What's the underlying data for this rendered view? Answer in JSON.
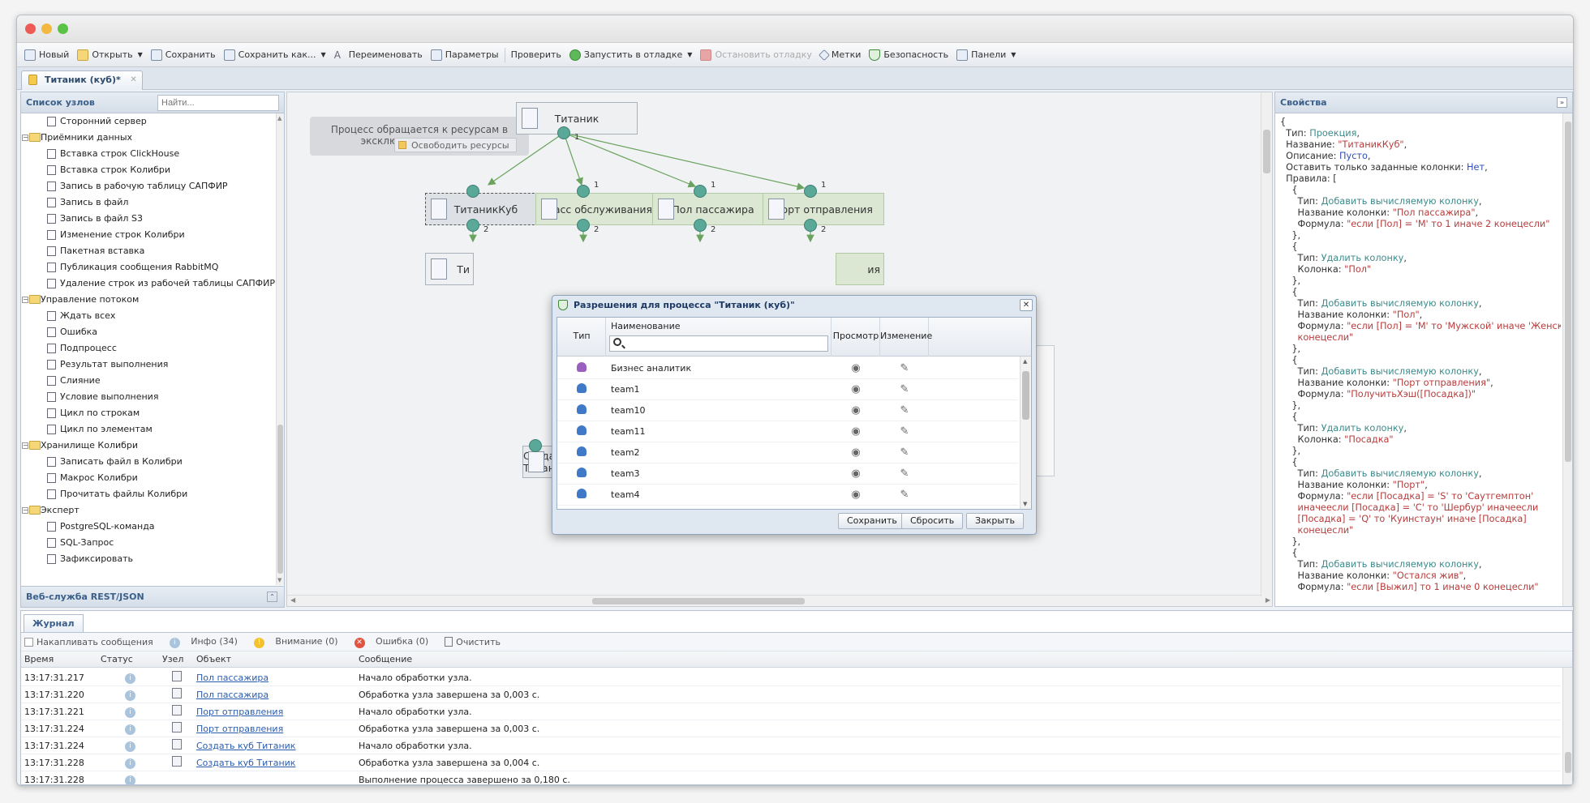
{
  "toolbar": {
    "new": "Новый",
    "open": "Открыть",
    "save": "Сохранить",
    "save_as": "Сохранить как...",
    "rename": "Переименовать",
    "params": "Параметры",
    "check": "Проверить",
    "run_debug": "Запустить в отладке",
    "stop_debug": "Остановить отладку",
    "tags": "Метки",
    "security": "Безопасность",
    "panels": "Панели"
  },
  "tab": {
    "label": "Титаник (куб)*"
  },
  "left": {
    "title": "Список узлов",
    "search_placeholder": "Найти...",
    "footer": "Веб-служба REST/JSON",
    "items": [
      {
        "t": "leaf",
        "label": "Сторонний сервер"
      },
      {
        "t": "grp",
        "label": "Приёмники данных"
      },
      {
        "t": "leaf",
        "label": "Вставка строк ClickHouse"
      },
      {
        "t": "leaf",
        "label": "Вставка строк Колибри"
      },
      {
        "t": "leaf",
        "label": "Запись в рабочую таблицу САПФИР"
      },
      {
        "t": "leaf",
        "label": "Запись в файл"
      },
      {
        "t": "leaf",
        "label": "Запись в файл S3"
      },
      {
        "t": "leaf",
        "label": "Изменение строк Колибри"
      },
      {
        "t": "leaf",
        "label": "Пакетная вставка"
      },
      {
        "t": "leaf",
        "label": "Публикация сообщения RabbitMQ"
      },
      {
        "t": "leaf",
        "label": "Удаление строк из рабочей таблицы САПФИР"
      },
      {
        "t": "grp",
        "label": "Управление потоком"
      },
      {
        "t": "leaf",
        "label": "Ждать всех"
      },
      {
        "t": "leaf",
        "label": "Ошибка"
      },
      {
        "t": "leaf",
        "label": "Подпроцесс"
      },
      {
        "t": "leaf",
        "label": "Результат выполнения"
      },
      {
        "t": "leaf",
        "label": "Слияние"
      },
      {
        "t": "leaf",
        "label": "Условие выполнения"
      },
      {
        "t": "leaf",
        "label": "Цикл по строкам"
      },
      {
        "t": "leaf",
        "label": "Цикл по элементам"
      },
      {
        "t": "grp",
        "label": "Хранилище Колибри"
      },
      {
        "t": "leaf",
        "label": "Записать файл в Колибри"
      },
      {
        "t": "leaf",
        "label": "Макрос Колибри"
      },
      {
        "t": "leaf",
        "label": "Прочитать файлы Колибри"
      },
      {
        "t": "grp",
        "label": "Эксперт"
      },
      {
        "t": "leaf",
        "label": "PostgreSQL-команда"
      },
      {
        "t": "leaf",
        "label": "SQL-Запрос"
      },
      {
        "t": "leaf",
        "label": "Зафиксировать"
      }
    ]
  },
  "canvas": {
    "message": "Процесс обращается к ресурсам в эксклюзивном режиме",
    "free_btn": "Освободить ресурсы",
    "nodes": {
      "titanic": "Титаник",
      "cube": "ТитаникКуб",
      "class": "Класс обслуживания",
      "sex": "Пол пассажира",
      "port": "Порт отправления",
      "create": "Создать куб Титаник",
      "partial_ti": "Ти",
      "partial_ya": "ия"
    },
    "port_labels": {
      "one": "1",
      "two": "2"
    }
  },
  "right": {
    "title": "Свойства",
    "lines": [
      [
        [
          "k",
          "{"
        ]
      ],
      [
        [
          "k",
          "  Тип: "
        ],
        [
          "v",
          "Проекция"
        ],
        [
          "k",
          ","
        ]
      ],
      [
        [
          "k",
          "  Название: "
        ],
        [
          "s",
          "\"ТитаникКуб\""
        ],
        [
          "k",
          ","
        ]
      ],
      [
        [
          "k",
          "  Описание: "
        ],
        [
          "b",
          "Пусто"
        ],
        [
          "k",
          ","
        ]
      ],
      [
        [
          "k",
          "  Оставить только заданные колонки: "
        ],
        [
          "b",
          "Нет"
        ],
        [
          "k",
          ","
        ]
      ],
      [
        [
          "k",
          "  Правила: ["
        ]
      ],
      [
        [
          "k",
          "    {"
        ]
      ],
      [
        [
          "k",
          "      Тип: "
        ],
        [
          "v",
          "Добавить вычисляемую колонку"
        ],
        [
          "k",
          ","
        ]
      ],
      [
        [
          "k",
          "      Название колонки: "
        ],
        [
          "s",
          "\"Пол пассажира\""
        ],
        [
          "k",
          ","
        ]
      ],
      [
        [
          "k",
          "      Формула: "
        ],
        [
          "s",
          "\"если [Пол] = 'М' то 1 иначе 2 конецесли\""
        ]
      ],
      [
        [
          "k",
          "    },"
        ]
      ],
      [
        [
          "k",
          "    {"
        ]
      ],
      [
        [
          "k",
          "      Тип: "
        ],
        [
          "v",
          "Удалить колонку"
        ],
        [
          "k",
          ","
        ]
      ],
      [
        [
          "k",
          "      Колонка: "
        ],
        [
          "s",
          "\"Пол\""
        ]
      ],
      [
        [
          "k",
          "    },"
        ]
      ],
      [
        [
          "k",
          "    {"
        ]
      ],
      [
        [
          "k",
          "      Тип: "
        ],
        [
          "v",
          "Добавить вычисляемую колонку"
        ],
        [
          "k",
          ","
        ]
      ],
      [
        [
          "k",
          "      Название колонки: "
        ],
        [
          "s",
          "\"Пол\""
        ],
        [
          "k",
          ","
        ]
      ],
      [
        [
          "k",
          "      Формула: "
        ],
        [
          "s",
          "\"если [Пол] = 'М' то 'Мужской' иначе 'Женский'"
        ]
      ],
      [
        [
          "s",
          "      конецесли\""
        ]
      ],
      [
        [
          "k",
          "    },"
        ]
      ],
      [
        [
          "k",
          "    {"
        ]
      ],
      [
        [
          "k",
          "      Тип: "
        ],
        [
          "v",
          "Добавить вычисляемую колонку"
        ],
        [
          "k",
          ","
        ]
      ],
      [
        [
          "k",
          "      Название колонки: "
        ],
        [
          "s",
          "\"Порт отправления\""
        ],
        [
          "k",
          ","
        ]
      ],
      [
        [
          "k",
          "      Формула: "
        ],
        [
          "s",
          "\"ПолучитьХэш([Посадка])\""
        ]
      ],
      [
        [
          "k",
          "    },"
        ]
      ],
      [
        [
          "k",
          "    {"
        ]
      ],
      [
        [
          "k",
          "      Тип: "
        ],
        [
          "v",
          "Удалить колонку"
        ],
        [
          "k",
          ","
        ]
      ],
      [
        [
          "k",
          "      Колонка: "
        ],
        [
          "s",
          "\"Посадка\""
        ]
      ],
      [
        [
          "k",
          "    },"
        ]
      ],
      [
        [
          "k",
          "    {"
        ]
      ],
      [
        [
          "k",
          "      Тип: "
        ],
        [
          "v",
          "Добавить вычисляемую колонку"
        ],
        [
          "k",
          ","
        ]
      ],
      [
        [
          "k",
          "      Название колонки: "
        ],
        [
          "s",
          "\"Порт\""
        ],
        [
          "k",
          ","
        ]
      ],
      [
        [
          "k",
          "      Формула: "
        ],
        [
          "s",
          "\"если [Посадка] = 'S' то 'Саутгемптон'"
        ]
      ],
      [
        [
          "s",
          "      иначеесли [Посадка] = 'C' то 'Шербур' иначеесли"
        ]
      ],
      [
        [
          "s",
          "      [Посадка] = 'Q' то 'Куинстаун' иначе [Посадка]"
        ]
      ],
      [
        [
          "s",
          "      конецесли\""
        ]
      ],
      [
        [
          "k",
          "    },"
        ]
      ],
      [
        [
          "k",
          "    {"
        ]
      ],
      [
        [
          "k",
          "      Тип: "
        ],
        [
          "v",
          "Добавить вычисляемую колонку"
        ],
        [
          "k",
          ","
        ]
      ],
      [
        [
          "k",
          "      Название колонки: "
        ],
        [
          "s",
          "\"Остался жив\""
        ],
        [
          "k",
          ","
        ]
      ],
      [
        [
          "k",
          "      Формула: "
        ],
        [
          "s",
          "\"если [Выжил] то 1 иначе 0 конецесли\""
        ]
      ]
    ]
  },
  "journal": {
    "tab": "Журнал",
    "accumulate": "Накапливать сообщения",
    "info": "Инфо (34)",
    "warn": "Внимание (0)",
    "error": "Ошибка (0)",
    "clear": "Очистить",
    "columns": [
      "Время",
      "Статус",
      "Узел",
      "Объект",
      "Сообщение"
    ],
    "rows": [
      {
        "time": "13:17:31.217",
        "object": "Пол пассажира",
        "message": "Начало обработки узла."
      },
      {
        "time": "13:17:31.220",
        "object": "Пол пассажира",
        "message": "Обработка узла завершена за 0,003 с."
      },
      {
        "time": "13:17:31.221",
        "object": "Порт отправления",
        "message": "Начало обработки узла."
      },
      {
        "time": "13:17:31.224",
        "object": "Порт отправления",
        "message": "Обработка узла завершена за 0,003 с."
      },
      {
        "time": "13:17:31.224",
        "object": "Создать куб Титаник",
        "message": "Начало обработки узла."
      },
      {
        "time": "13:17:31.228",
        "object": "Создать куб Титаник",
        "message": "Обработка узла завершена за 0,004 с."
      },
      {
        "time": "13:17:31.228",
        "object": "",
        "message": "Выполнение процесса завершено за 0,180 с."
      }
    ]
  },
  "dialog": {
    "title": "Разрешения для процесса \"Титаник (куб)\"",
    "columns": {
      "type": "Тип",
      "name": "Наименование",
      "view": "Просмотр",
      "edit": "Изменение"
    },
    "rows": [
      {
        "name": "Бизнес аналитик",
        "group": true
      },
      {
        "name": "team1",
        "group": false
      },
      {
        "name": "team10",
        "group": false
      },
      {
        "name": "team11",
        "group": false
      },
      {
        "name": "team2",
        "group": false
      },
      {
        "name": "team3",
        "group": false
      },
      {
        "name": "team4",
        "group": false
      }
    ],
    "buttons": {
      "save": "Сохранить",
      "reset": "Сбросить",
      "close": "Закрыть"
    }
  }
}
